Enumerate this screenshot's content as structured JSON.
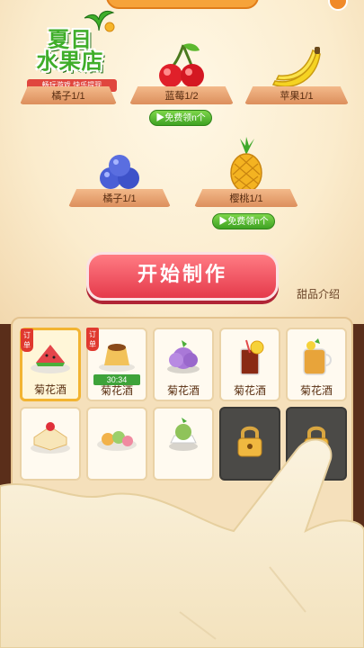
{
  "logo": {
    "title_line1": "夏日",
    "title_line2": "水果店",
    "subtitle": "畅玩游戏  快乐提现"
  },
  "shelves": [
    {
      "id": "orange",
      "label": "橘子1/1",
      "fruit": "orange"
    },
    {
      "id": "cherry",
      "label": "蓝莓1/2",
      "fruit": "cherry"
    },
    {
      "id": "banana",
      "label": "苹果1/1",
      "fruit": "banana"
    },
    {
      "id": "blueberry",
      "label": "橘子1/1",
      "fruit": "blueberry"
    },
    {
      "id": "pineapple",
      "label": "樱桃1/1",
      "fruit": "pineapple"
    }
  ],
  "free_buttons": [
    {
      "label": "▶免费领n个"
    },
    {
      "label": "▶免费领n个"
    }
  ],
  "start_button": {
    "label": "开始制作"
  },
  "dessert_intro": {
    "label": "甜品介绍"
  },
  "recipes": [
    {
      "name": "菊花酒",
      "order_tag": "订单",
      "selected": true
    },
    {
      "name": "菊花酒",
      "order_tag": "订单",
      "timer": "30:34"
    },
    {
      "name": "菊花酒",
      "red_dot": true
    },
    {
      "name": "菊花酒"
    },
    {
      "name": "菊花酒"
    }
  ],
  "recipes_row2": [
    {
      "dish": "cake"
    },
    {
      "dish": "sushi"
    },
    {
      "dish": "matcha"
    },
    {
      "locked": true
    },
    {
      "locked": true
    }
  ],
  "colors": {
    "start_button": "#e53a4b",
    "free_button": "#3fa223",
    "panel": "#f5e0bb",
    "accent_orange": "#f6a33a"
  }
}
